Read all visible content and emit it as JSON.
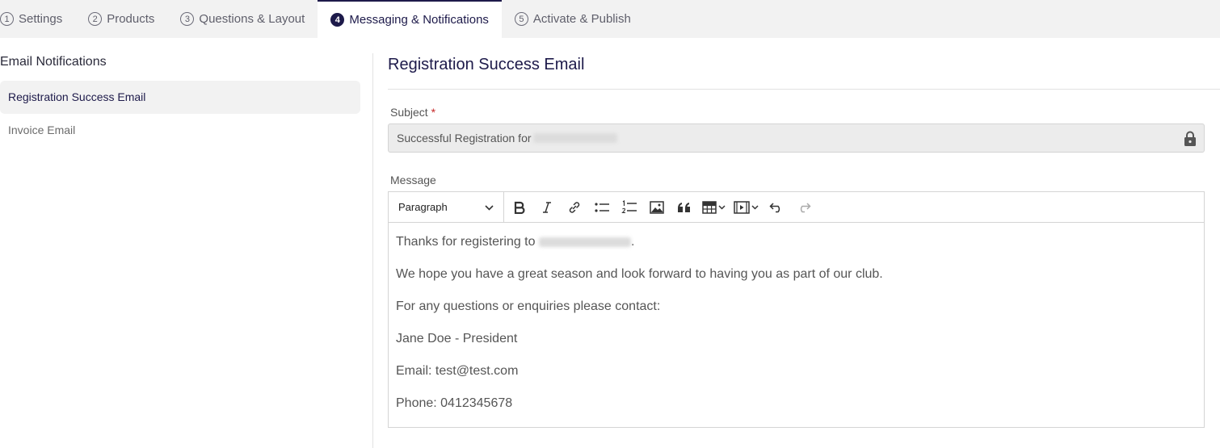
{
  "tabs": [
    {
      "num": "1",
      "label": "Settings",
      "active": false
    },
    {
      "num": "2",
      "label": "Products",
      "active": false
    },
    {
      "num": "3",
      "label": "Questions & Layout",
      "active": false
    },
    {
      "num": "4",
      "label": "Messaging & Notifications",
      "active": true
    },
    {
      "num": "5",
      "label": "Activate & Publish",
      "active": false
    }
  ],
  "sidebar": {
    "title": "Email Notifications",
    "items": [
      {
        "label": "Registration Success Email",
        "active": true
      },
      {
        "label": "Invoice Email",
        "active": false
      }
    ]
  },
  "main": {
    "title": "Registration Success Email",
    "subject_label": "Subject",
    "required_mark": "*",
    "subject_value": "Successful Registration for",
    "message_label": "Message",
    "format_select": "Paragraph",
    "toolbar_icons": [
      "bold-icon",
      "italic-icon",
      "link-icon",
      "bullet-list-icon",
      "numbered-list-icon",
      "image-icon",
      "quote-icon",
      "table-icon",
      "media-icon",
      "undo-icon",
      "redo-icon"
    ],
    "body": {
      "line1": "Thanks for registering to",
      "line1_end": ".",
      "line2": "We hope you have a great season and look forward to having you as part of our club.",
      "line3": "For any questions or enquiries please contact:",
      "line4": "Jane Doe - President",
      "line5": "Email: test@test.com",
      "line6": "Phone: 0412345678"
    }
  },
  "colors": {
    "accent": "#1d1a4a",
    "required": "#c62828",
    "tabbar_bg": "#f2f2f2"
  }
}
